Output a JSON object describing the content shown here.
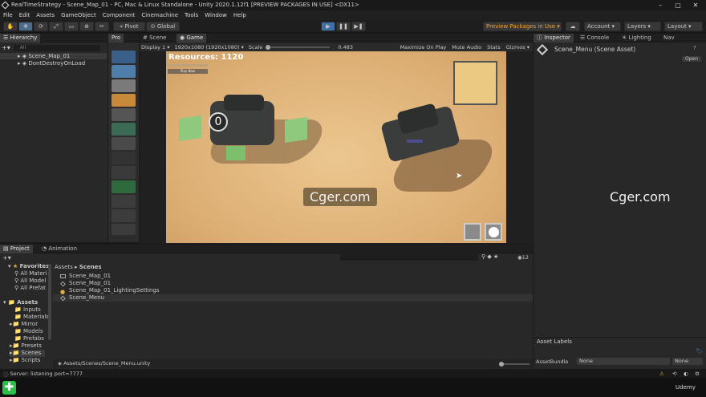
{
  "window": {
    "title": "RealTimeStrategy - Scene_Map_01 - PC, Mac & Linux Standalone - Unity 2020.1.12f1 [PREVIEW PACKAGES IN USE] <DX11>"
  },
  "menu": [
    "File",
    "Edit",
    "Assets",
    "GameObject",
    "Component",
    "Cinemachine",
    "Tools",
    "Window",
    "Help"
  ],
  "toolbar": {
    "pivot": "Pivot",
    "global": "Global",
    "preview_packages": "Preview Packages in Use ▾",
    "account": "Account",
    "layers": "Layers",
    "layout": "Layout"
  },
  "hierarchy": {
    "tab": "Hierarchy",
    "search_placeholder": "All",
    "items": [
      "Scene_Map_01",
      "DontDestroyOnLoad"
    ]
  },
  "tools_panel": {
    "tab": "Pro"
  },
  "scene_tabs": {
    "scene": "Scene",
    "game": "Game"
  },
  "game_toolbar": {
    "display": "Display 1",
    "resolution": "1920x1080 (1920x1080)",
    "scale_label": "Scale",
    "scale_value": "0.483",
    "maximize": "Maximize On Play",
    "mute": "Mute Audio",
    "stats": "Stats",
    "gizmos": "Gizmos"
  },
  "game_view": {
    "resources": "Resources: 1120",
    "unit_counter": "0",
    "button_text": "Play Now"
  },
  "inspector": {
    "tabs": [
      "Inspector",
      "Console",
      "Lighting",
      "Nav"
    ],
    "asset_name": "Scene_Menu (Scene Asset)",
    "open_button": "Open",
    "asset_labels": "Asset Labels",
    "asset_bundle_label": "AssetBundle",
    "asset_bundle_value": "None",
    "asset_variant_value": "None"
  },
  "project": {
    "tabs": [
      "Project",
      "Animation"
    ],
    "favorites_label": "Favorites",
    "favorites": [
      "All Materi",
      "All Model",
      "All Prefat"
    ],
    "assets_label": "Assets",
    "folders": [
      "Inputs",
      "Materials",
      "Mirror",
      "Models",
      "Prefabs",
      "Presets",
      "Scenes",
      "Scripts"
    ],
    "breadcrumb_root": "Assets",
    "breadcrumb_current": "Scenes",
    "files": [
      "Scene_Map_01",
      "Scene_Map_01",
      "Scene_Map_01_LightingSettings",
      "Scene_Menu"
    ],
    "path": "Assets/Scenes/Scene_Menu.unity",
    "count": "12"
  },
  "status": {
    "message": "Server: listening port=7777"
  },
  "watermarks": [
    "Cger.com",
    "Cger.com"
  ],
  "udemy": "Udemy",
  "colors": {
    "accent": "#4c6a8a",
    "game_bg": "#e0b87e",
    "preview": "#f0a030"
  }
}
